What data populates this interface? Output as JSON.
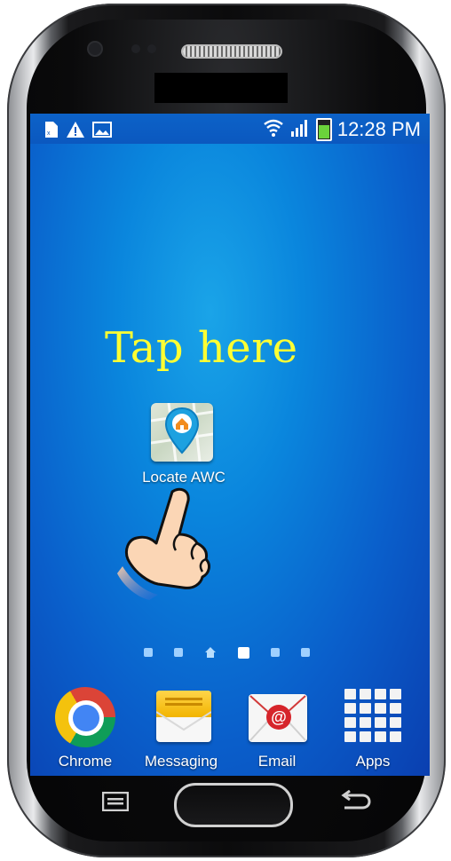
{
  "status_bar": {
    "left_icons": [
      "document-icon",
      "warning-icon",
      "image-icon"
    ],
    "right_icons": [
      "wifi-icon",
      "signal-icon",
      "battery-icon"
    ],
    "time": "12:28 PM"
  },
  "instruction": "Tap here",
  "home_app": {
    "label": "Locate AWC",
    "icon": "map-pin-icon"
  },
  "page_indicator": {
    "count": 6,
    "home_index": 2,
    "active_index": 3
  },
  "dock": [
    {
      "label": "Chrome",
      "icon": "chrome-icon"
    },
    {
      "label": "Messaging",
      "icon": "messaging-icon"
    },
    {
      "label": "Email",
      "icon": "email-icon"
    },
    {
      "label": "Apps",
      "icon": "apps-grid-icon"
    }
  ],
  "hardware_buttons": [
    "menu",
    "home",
    "back"
  ],
  "colors": {
    "instruction": "#ffff33",
    "screen_center": "#1aa4e8",
    "screen_edge": "#0a3fb0"
  }
}
